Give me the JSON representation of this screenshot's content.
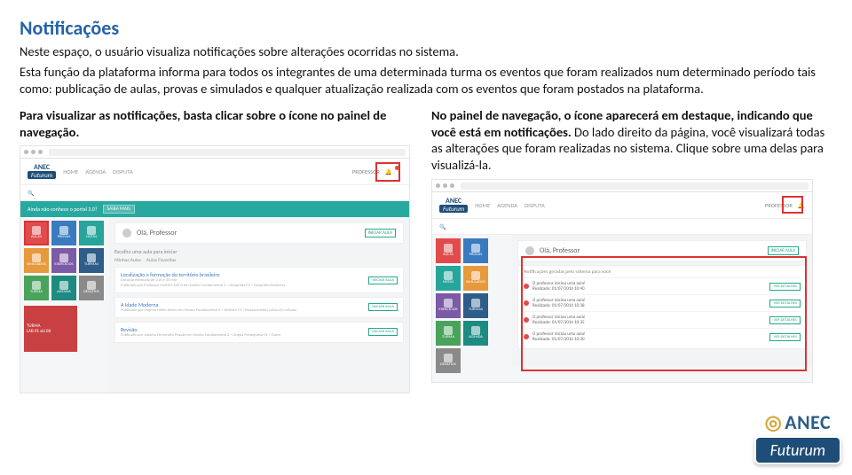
{
  "title": "Notificações",
  "body1": "Neste espaço, o usuário visualiza notificações sobre alterações ocorridas no sistema.",
  "body2": "Esta função da plataforma informa para todos os integrantes de uma determinada turma os eventos que foram realizados num determinado período tais como: publicação de aulas, provas e simulados e qualquer atualização realizada com os eventos que foram postados na plataforma.",
  "left": {
    "caption": "Para visualizar as notificações, basta clicar sobre o ícone no painel de navegação."
  },
  "right": {
    "caption_bold": "No painel de navegação, o ícone aparecerá em destaque, indicando que você está em notificações.",
    "caption_rest": " Do lado direito da página, você visualizará todas as alterações que foram realizadas no sistema. Clique sobre uma delas para visualizá-la."
  },
  "app": {
    "logo_main": "ANEC",
    "logo_sub": "Futurum",
    "nav": [
      "HOME",
      "AGENDA",
      "DISPUTA"
    ],
    "user_role": "PROFESSOR",
    "header_btn": "INICIAR AULA",
    "greeting": "Olá, Professor",
    "banner_text": "Ainda não conhece o portal 3.0?",
    "banner_btn": "SAIBA MAIS",
    "subhead": "Escolha uma aula para iniciar",
    "tabs": [
      "Minhas Aulas",
      "Aulas Favoritas"
    ],
    "tiles": [
      "AULAS",
      "PROVAS",
      "NOTAS",
      "SIMULADOS",
      "EXERCÍCIOS",
      "TURMAS",
      "TURMA",
      "AGENDA",
      "DESAFIOS"
    ],
    "big_tile": {
      "l1": "TURMA",
      "l2": "LAB 01 sbi 08"
    },
    "lessons": [
      {
        "title": "Localização e formação do território brasileiro",
        "meta1": "Duração estimada de 01h e 30 min",
        "meta2": "Publicado por Professor MOISES NETO em Ensino Fundamental 2 > Geografia F2 > Geografia brasileira"
      },
      {
        "title": "A Idade Moderna",
        "meta1": "Publicado por Virginia Helen Abreu em Ensino Fundamental 2 > História F2 > Renascimento cultural e urbano",
        "meta2": ""
      },
      {
        "title": "Revisão",
        "meta1": "Publicado por Janaína Fernandes Possati em Ensino Fundamental 2 > Língua Portuguesa F2 > Outro",
        "meta2": ""
      }
    ],
    "lesson_btn": "INICIAR AULA",
    "notif_panel_title": "Notificações geradas pelo sistema para você",
    "notif_items": [
      {
        "text": "O professor iniciou uma aula!",
        "sub": "Realizado: 01/07/2016 10:40"
      },
      {
        "text": "O professor iniciou uma aula!",
        "sub": "Realizado: 01/07/2016 10:38"
      },
      {
        "text": "O professor iniciou uma aula!",
        "sub": "Realizado: 01/07/2016 10:35"
      },
      {
        "text": "O professor iniciou uma aula!",
        "sub": "Realizado: 01/07/2016 10:30"
      }
    ],
    "notif_btn": "VER DETALHES"
  },
  "brand": {
    "anec": "ANEC",
    "futurum": "Futurum"
  }
}
